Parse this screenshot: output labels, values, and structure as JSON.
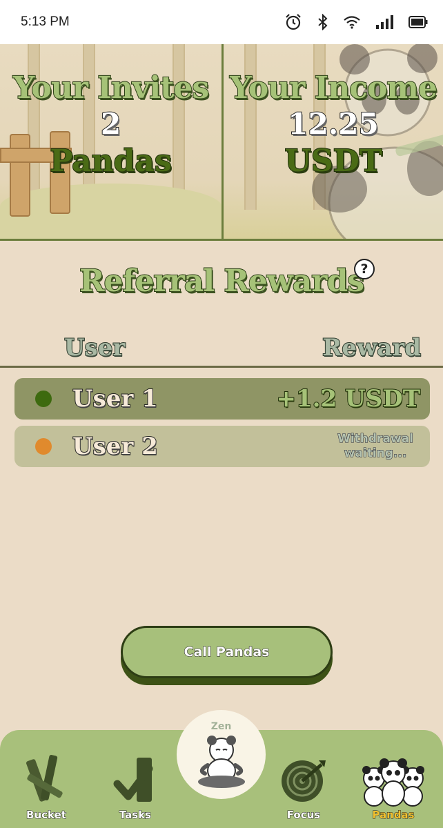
{
  "status_bar": {
    "time": "5:13 PM",
    "battery_icon": "battery-icon",
    "signal_icon": "signal-icon",
    "wifi_icon": "wifi-icon",
    "bluetooth_icon": "bluetooth-icon",
    "alarm_icon": "alarm-icon"
  },
  "invites": {
    "title": "Your Invites",
    "count": "2",
    "unit": "Pandas"
  },
  "income": {
    "title": "Your Income",
    "amount": "12.25",
    "unit": "USDT"
  },
  "referral": {
    "title": "Referral Rewards",
    "help": "?",
    "col_user": "User",
    "col_reward": "Reward",
    "rows": [
      {
        "user": "User 1",
        "reward": "+1.2 USDT",
        "status_color": "#3d6a0f"
      },
      {
        "user": "User 2",
        "status": "Withdrawal waiting...",
        "status_color": "#e08a2d"
      }
    ]
  },
  "call_button": {
    "label": "Call Pandas"
  },
  "nav": {
    "zen": "Zen",
    "items": [
      {
        "label": "Bucket",
        "icon": "bamboo-bucket-icon"
      },
      {
        "label": "Tasks",
        "icon": "tasks-check-icon"
      },
      {
        "label": "Focus",
        "icon": "target-icon"
      },
      {
        "label": "Pandas",
        "icon": "pandas-group-icon",
        "active": true
      }
    ]
  },
  "colors": {
    "background": "#ebdcc7",
    "accent_green": "#a8c07b",
    "dark_green": "#3d5216",
    "active_nav": "#f2c230"
  }
}
